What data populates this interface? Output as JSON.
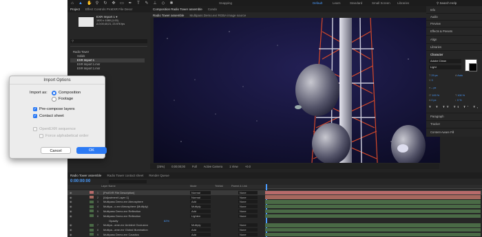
{
  "menubar": {
    "workspaces": [
      "Default",
      "Learn",
      "Standard",
      "Small Screen",
      "Libraries"
    ],
    "active_workspace": "Default",
    "search_placeholder": "Search Help",
    "snapping": "Snapping"
  },
  "project_panel": {
    "tabs": [
      "Project",
      "Effect Controls ProEXR File Descr"
    ],
    "item_name": "EXR Import 1 ▾",
    "item_info": [
      "1920 x 1080 (1.00)",
      "Δ 0;00;40;21, 23.976 fps"
    ],
    "search_placeholder": "",
    "tree": [
      {
        "label": "Radio Tower",
        "selected": false,
        "indent": 0
      },
      {
        "label": "Solids",
        "selected": false,
        "indent": 1
      },
      {
        "label": "EXR Import 1",
        "selected": true,
        "indent": 1
      },
      {
        "label": "EXR Import 1.msr",
        "selected": false,
        "indent": 1
      },
      {
        "label": "EXR Import 1.msr",
        "selected": false,
        "indent": 1
      }
    ]
  },
  "composition_panel": {
    "tabs": [
      "Composition Radio Tower assemble",
      "Condo"
    ],
    "subtabs": [
      "Radio Tower assemble",
      "Multipass Demo.exr RGBA image source"
    ],
    "footer": [
      "(25%)",
      "0;00;00;00",
      "Full",
      "Active Camera",
      "1 View",
      "+0.0"
    ]
  },
  "right_panels": {
    "items": [
      "Info",
      "Audio",
      "Preview",
      "Effects & Presets",
      "Align",
      "Libraries",
      "Character"
    ],
    "character": {
      "font": "Adobe Clean",
      "style": "Light",
      "size": "29 px",
      "leading": "Auto",
      "tracking": "0",
      "vscale": "100 %",
      "hscale": "100 %",
      "baseline": "0 px",
      "tsume": "0 %",
      "unit": "– px"
    },
    "lower_items": [
      "Paragraph",
      "Tracker",
      "Content-Aware Fill"
    ]
  },
  "timeline": {
    "tabs": [
      "Radio Tower assemble",
      "Radio Tower contact sheet",
      "Render Queue"
    ],
    "timecode": "0:00:00:00",
    "columns": {
      "layer_name": "Layer Name",
      "mode": "Mode",
      "trkmat": "TrkMat",
      "parent": "Parent & Link"
    },
    "layers": [
      {
        "num": "1",
        "name": "[ProEXR File Description]",
        "mode": "Normal",
        "parent": "None",
        "color": "#b86b6b"
      },
      {
        "num": "2",
        "name": "[Adjustment Layer 1]",
        "mode": "Normal",
        "parent": "None",
        "color": "#a6675e"
      },
      {
        "num": "3",
        "name": "Multipass Demo.exr Atmosphere",
        "mode": "Add",
        "parent": "None",
        "color": "#4a6a46"
      },
      {
        "num": "4",
        "name": "Multipa...o.exr Atmosphere (Multiply)",
        "mode": "Multiply",
        "parent": "None",
        "color": "#4a6a46"
      },
      {
        "num": "5",
        "name": "Multipass Demo.exr Reflection",
        "mode": "Add",
        "parent": "None",
        "color": "#4a6a46"
      },
      {
        "num": "6",
        "name": "Multipass Demo.exr Reflection",
        "mode": "Lighten",
        "parent": "None",
        "color": "#4a6a46"
      },
      {
        "num": "",
        "name": "Opacity",
        "mode": "",
        "parent": "",
        "color": "#3a3a3a",
        "value": "62%"
      },
      {
        "num": "7",
        "name": "Multipa...ame.exr Ambient Occlusion",
        "mode": "Multiply",
        "parent": "None",
        "color": "#4a6a46"
      },
      {
        "num": "8",
        "name": "Multipa...ame.exr Global Illumination",
        "mode": "Add",
        "parent": "None",
        "color": "#4a6a46"
      },
      {
        "num": "9",
        "name": "Multipass Demo.exr Caustics",
        "mode": "Add",
        "parent": "None",
        "color": "#4a6a46"
      }
    ]
  },
  "dialog": {
    "title": "Import Options",
    "import_as_label": "Import as:",
    "radio_composition": "Composition",
    "radio_footage": "Footage",
    "precompose_label": "Pre-compose layers",
    "contact_sheet_label": "Contact sheet",
    "openexr_label": "OpenEXR sequence",
    "alpha_order_label": "Force alphabetical order",
    "cancel_label": "Cancel",
    "ok_label": "OK"
  },
  "colors": {
    "accent": "#2c7af4",
    "ae_blue": "#4a9cff",
    "panel_bg": "#232323"
  }
}
